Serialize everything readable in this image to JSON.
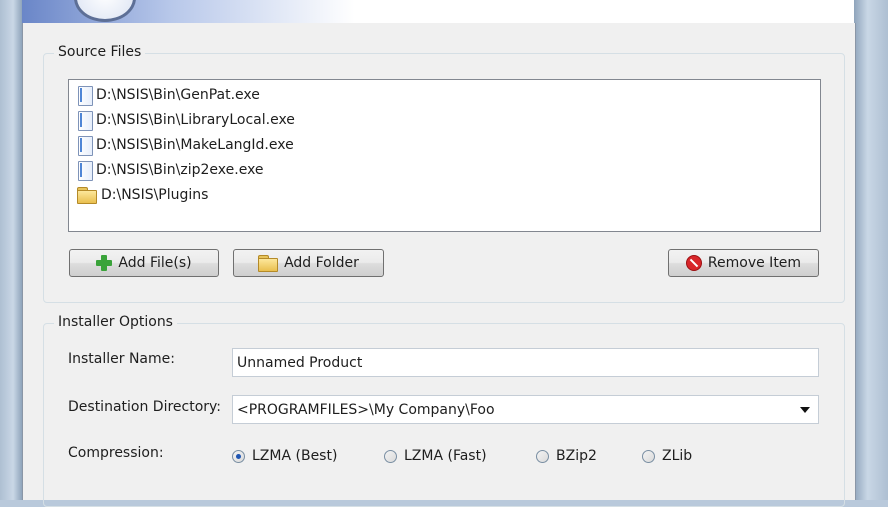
{
  "source_files": {
    "group_label": "Source Files",
    "items": [
      {
        "type": "file",
        "label": "D:\\NSIS\\Bin\\GenPat.exe",
        "icon": "file-icon"
      },
      {
        "type": "file",
        "label": "D:\\NSIS\\Bin\\LibraryLocal.exe",
        "icon": "file-icon"
      },
      {
        "type": "file",
        "label": "D:\\NSIS\\Bin\\MakeLangId.exe",
        "icon": "file-icon"
      },
      {
        "type": "file",
        "label": "D:\\NSIS\\Bin\\zip2exe.exe",
        "icon": "file-icon"
      },
      {
        "type": "folder",
        "label": "D:\\NSIS\\Plugins",
        "icon": "folder-icon"
      }
    ],
    "buttons": {
      "add_files": "Add File(s)",
      "add_folder": "Add Folder",
      "remove_item": "Remove Item"
    }
  },
  "installer_options": {
    "group_label": "Installer Options",
    "installer_name_label": "Installer Name:",
    "installer_name_value": "Unnamed Product",
    "destination_label": "Destination Directory:",
    "destination_value": "<PROGRAMFILES>\\My Company\\Foo",
    "compression_label": "Compression:",
    "compression_options": [
      {
        "label": "LZMA (Best)",
        "selected": true
      },
      {
        "label": "LZMA (Fast)",
        "selected": false
      },
      {
        "label": "BZip2",
        "selected": false
      },
      {
        "label": "ZLib",
        "selected": false
      }
    ]
  }
}
